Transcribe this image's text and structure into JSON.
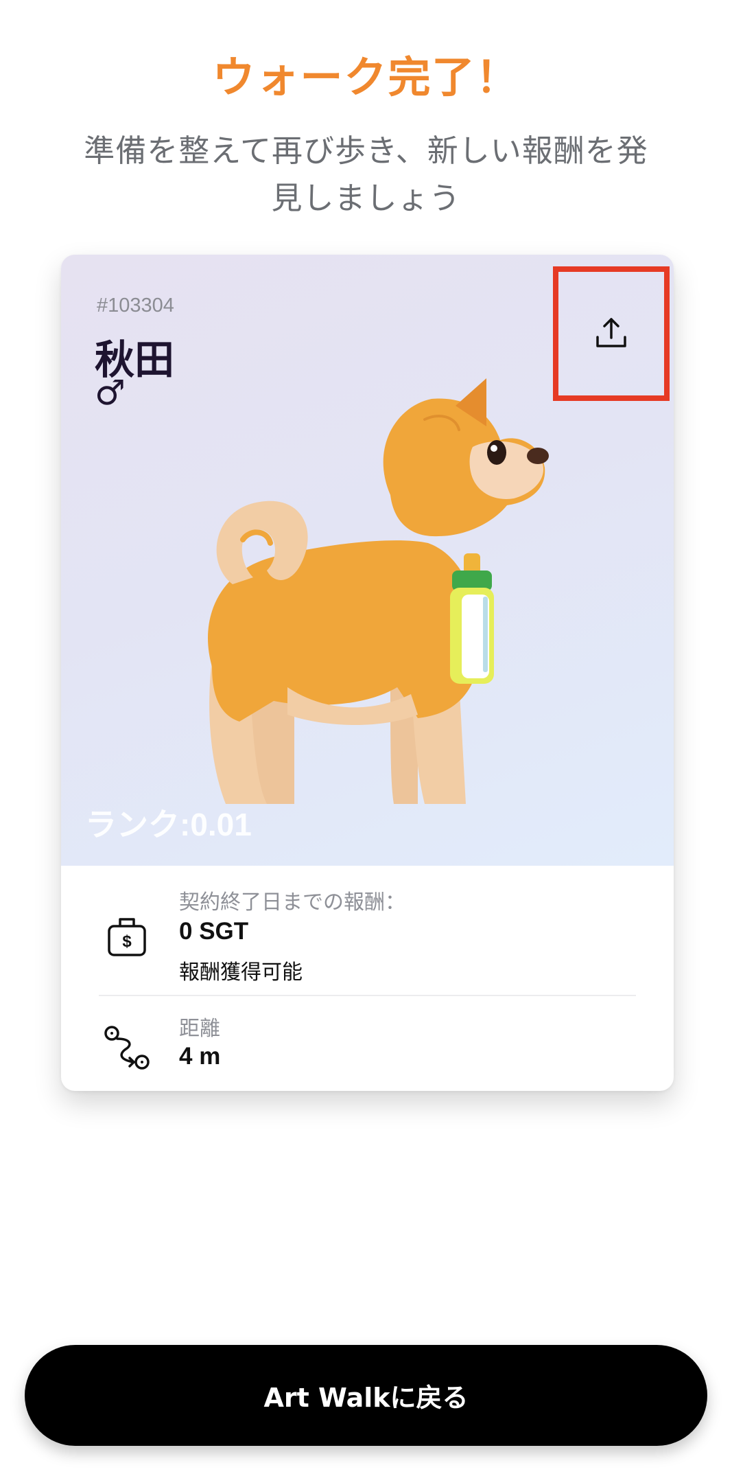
{
  "header": {
    "title": "ウォーク完了！",
    "subtitle_line1": "準備を整えて再び歩き、新しい報酬を発",
    "subtitle_line2": "見しましょう"
  },
  "card": {
    "pet_id": "#103304",
    "pet_name": "秋田",
    "gender_symbol": "♂",
    "rank_text": "ランク:0.01",
    "share_icon": "share-upload-icon",
    "reward": {
      "label": "契約終了日までの報酬：",
      "value": "0 SGT",
      "sub": "報酬獲得可能",
      "icon": "money-bag-icon"
    },
    "distance": {
      "label": "距離",
      "value": "4 m",
      "icon": "route-icon"
    }
  },
  "footer": {
    "back_button_label": "Art Walkに戻る"
  },
  "colors": {
    "accent": "#F0882E",
    "highlight_box": "#E63A24",
    "button_bg": "#000000"
  }
}
